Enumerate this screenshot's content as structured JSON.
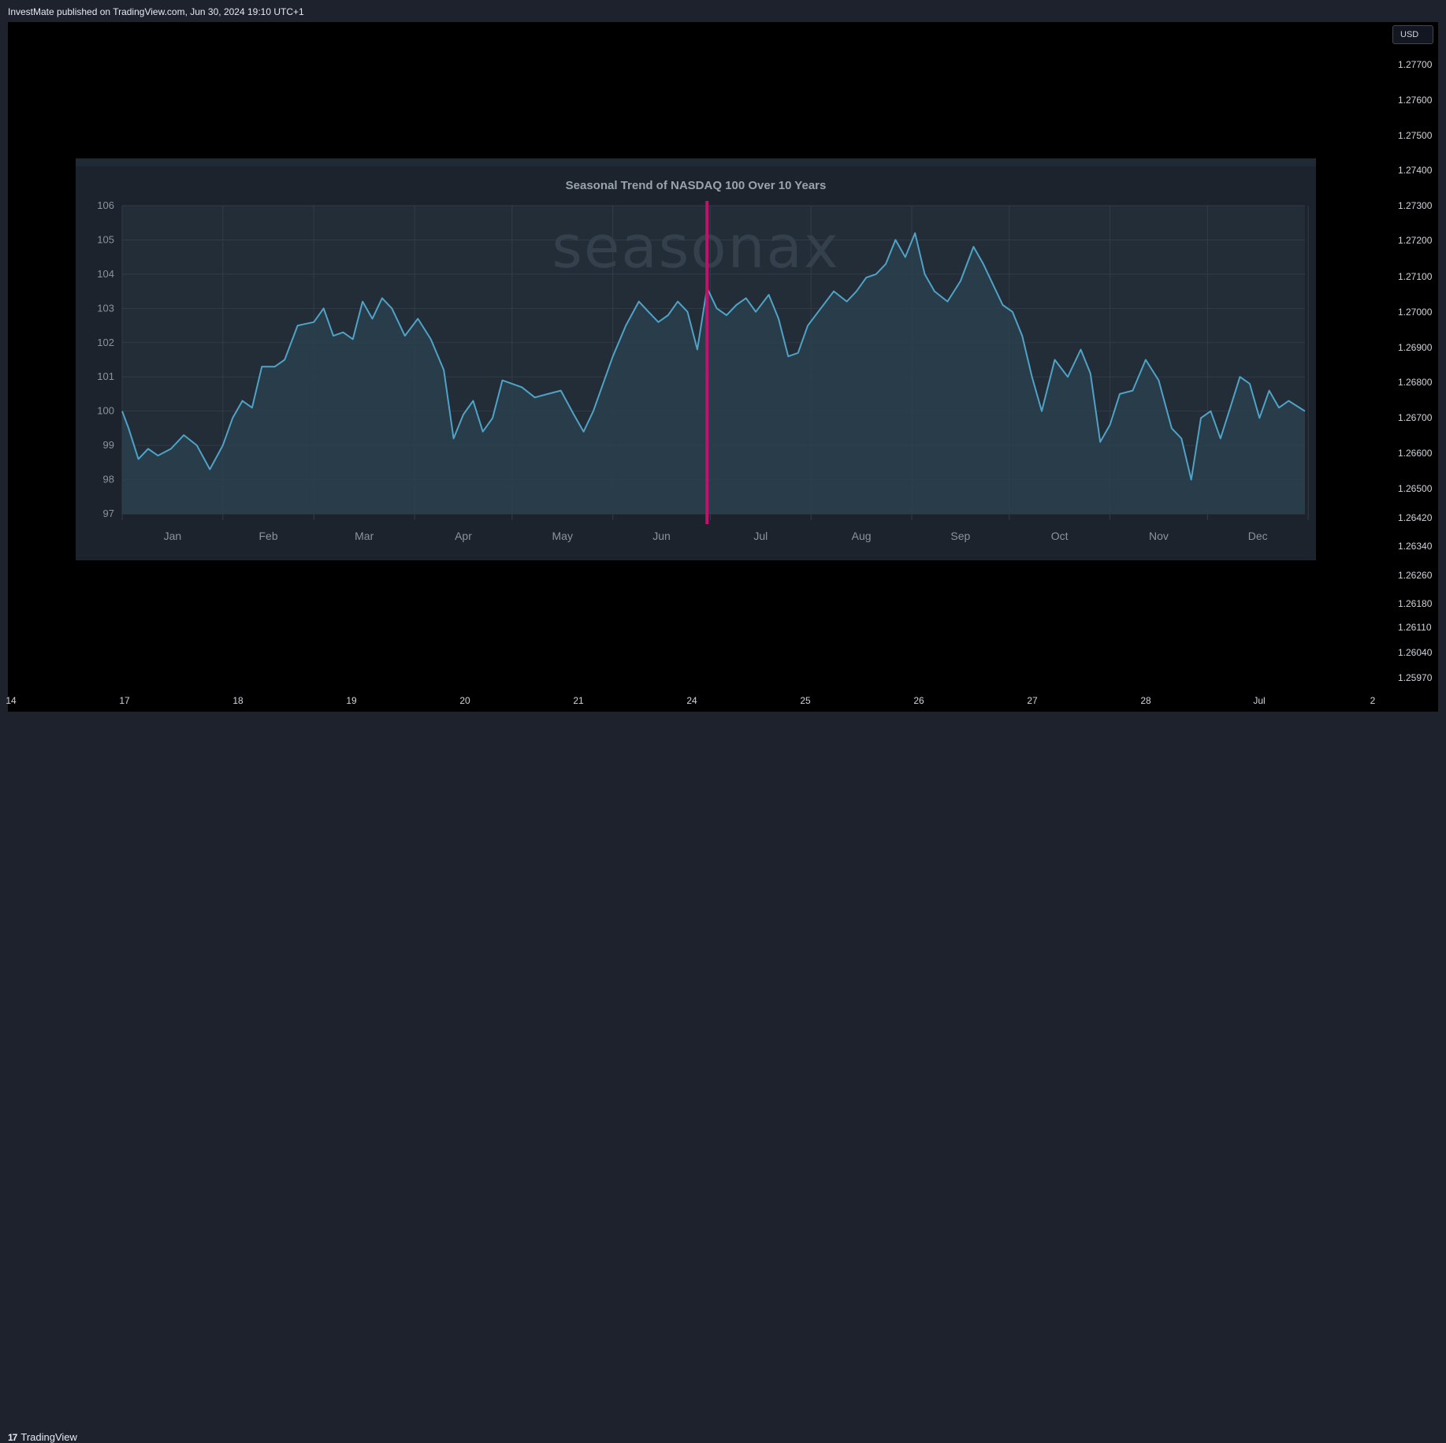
{
  "header": {
    "publisher_text": "InvestMate published on TradingView.com, Jun 30, 2024 19:10 UTC+1"
  },
  "currency_button": {
    "label": "USD"
  },
  "price_axis": {
    "ticks": [
      "1.27700",
      "1.27600",
      "1.27500",
      "1.27400",
      "1.27300",
      "1.27200",
      "1.27100",
      "1.27000",
      "1.26900",
      "1.26800",
      "1.26700",
      "1.26600",
      "1.26500",
      "1.26420",
      "1.26340",
      "1.26260",
      "1.26180",
      "1.26110",
      "1.26040",
      "1.25970"
    ]
  },
  "time_axis": {
    "ticks": [
      "14",
      "17",
      "18",
      "19",
      "20",
      "21",
      "24",
      "25",
      "26",
      "27",
      "28",
      "Jul",
      "2"
    ]
  },
  "footer": {
    "brand": "TradingView",
    "brand_mark": "17"
  },
  "colors": {
    "line": "#4fa3c7",
    "marker": "#c0136b",
    "panel": "#1c232c",
    "grid": "#323c48"
  },
  "chart_data": {
    "type": "area",
    "title": "Seasonal Trend of NASDAQ 100 Over 10 Years",
    "watermark": "seasonax",
    "xlabel": "",
    "ylabel": "",
    "ylim": [
      97,
      106
    ],
    "y_ticks": [
      106,
      105,
      104,
      103,
      102,
      101,
      100,
      99,
      98,
      97
    ],
    "months": [
      "Jan",
      "Feb",
      "Mar",
      "Apr",
      "May",
      "Jun",
      "Jul",
      "Aug",
      "Sep",
      "Oct",
      "Nov",
      "Dec"
    ],
    "x_unit": "day of year",
    "current_day_marker": 181,
    "grid": true,
    "series": [
      {
        "x": [
          1,
          3,
          6,
          9,
          12,
          16,
          20,
          24,
          28,
          32,
          35,
          38,
          41,
          44,
          48,
          51,
          55,
          60,
          63,
          66,
          69,
          72,
          75,
          78,
          81,
          84,
          88,
          92,
          96,
          100,
          103,
          106,
          109,
          112,
          115,
          118,
          121,
          124,
          128,
          132,
          136,
          140,
          143,
          146,
          149,
          152,
          156,
          160,
          163,
          166,
          169,
          172,
          175,
          178,
          181,
          184,
          187,
          190,
          193,
          196,
          200,
          203,
          206,
          209,
          212,
          216,
          220,
          224,
          227,
          230,
          233,
          236,
          239,
          242,
          245,
          248,
          251,
          255,
          259,
          263,
          266,
          269,
          272,
          275,
          278,
          281,
          284,
          288,
          292,
          296,
          299,
          302,
          305,
          308,
          312,
          316,
          320,
          324,
          327,
          330,
          333,
          336,
          339,
          342,
          345,
          348,
          351,
          354,
          357,
          360,
          365
        ],
        "values": [
          100.0,
          99.5,
          98.6,
          98.9,
          98.7,
          98.9,
          99.3,
          99.0,
          98.3,
          99.0,
          99.8,
          100.3,
          100.1,
          101.3,
          101.3,
          101.5,
          102.5,
          102.6,
          103.0,
          102.2,
          102.3,
          102.1,
          103.2,
          102.7,
          103.3,
          103.0,
          102.2,
          102.7,
          102.1,
          101.2,
          99.2,
          99.9,
          100.3,
          99.4,
          99.8,
          100.9,
          100.8,
          100.7,
          100.4,
          100.5,
          100.6,
          99.9,
          99.4,
          100.0,
          100.8,
          101.6,
          102.5,
          103.2,
          102.9,
          102.6,
          102.8,
          103.2,
          102.9,
          101.8,
          103.6,
          103.0,
          102.8,
          103.1,
          103.3,
          102.9,
          103.4,
          102.7,
          101.6,
          101.7,
          102.5,
          103.0,
          103.5,
          103.2,
          103.5,
          103.9,
          104.0,
          104.3,
          105.0,
          104.5,
          105.2,
          104.0,
          103.5,
          103.2,
          103.8,
          104.8,
          104.3,
          103.7,
          103.1,
          102.9,
          102.2,
          101.0,
          100.0,
          101.5,
          101.0,
          101.8,
          101.1,
          99.1,
          99.6,
          100.5,
          100.6,
          101.5,
          100.9,
          99.5,
          99.2,
          98.0,
          99.8,
          100.0,
          99.2,
          100.1,
          101.0,
          100.8,
          99.8,
          100.6,
          100.1,
          100.3,
          100.0
        ]
      }
    ]
  }
}
